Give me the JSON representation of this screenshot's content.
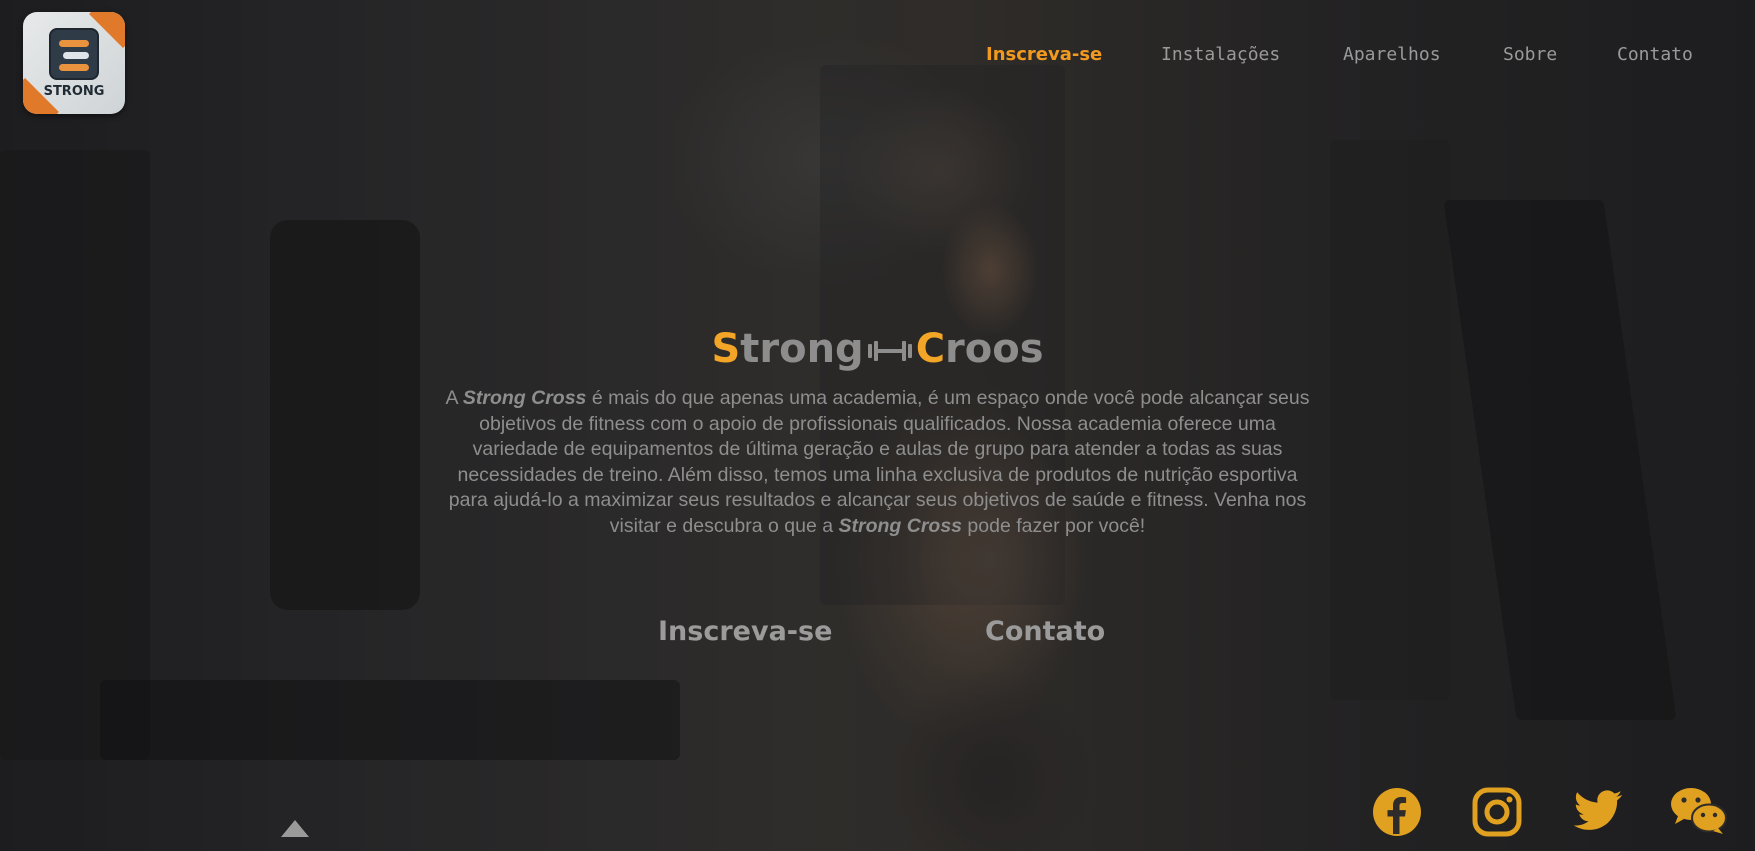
{
  "header": {
    "logo_text": "STRONG",
    "nav": [
      {
        "label": "Inscreva-se",
        "active": true
      },
      {
        "label": "Instalações",
        "active": false
      },
      {
        "label": "Aparelhos",
        "active": false
      },
      {
        "label": "Sobre",
        "active": false
      },
      {
        "label": "Contato",
        "active": false
      }
    ]
  },
  "hero": {
    "title_first_initial": "S",
    "title_first_rest": "trong",
    "title_second_initial": "C",
    "title_second_rest": "roos",
    "paragraph": {
      "intro": "A ",
      "brand_1": "Strong Cross",
      "body": " é mais do que apenas uma academia, é um espaço onde você pode alcançar seus objetivos de fitness com o apoio de profissionais qualificados. Nossa academia oferece uma variedade de equipamentos de última geração e aulas de grupo para atender a todas as suas necessidades de treino. Além disso, temos uma linha exclusiva de produtos de nutrição esportiva para ajudá-lo a maximizar seus resultados e alcançar seus objetivos de saúde e fitness. Venha nos visitar e descubra o que a ",
      "brand_2": "Strong Cross",
      "outro": " pode fazer por você!"
    },
    "cta_primary": "Inscreva-se",
    "cta_secondary": "Contato"
  },
  "footer": {
    "social": [
      "facebook-icon",
      "instagram-icon",
      "twitter-icon",
      "wechat-icon"
    ]
  },
  "colors": {
    "accent": "#f2a526",
    "nav_active": "#f29a1f",
    "text_muted": "#8e8e8e"
  }
}
